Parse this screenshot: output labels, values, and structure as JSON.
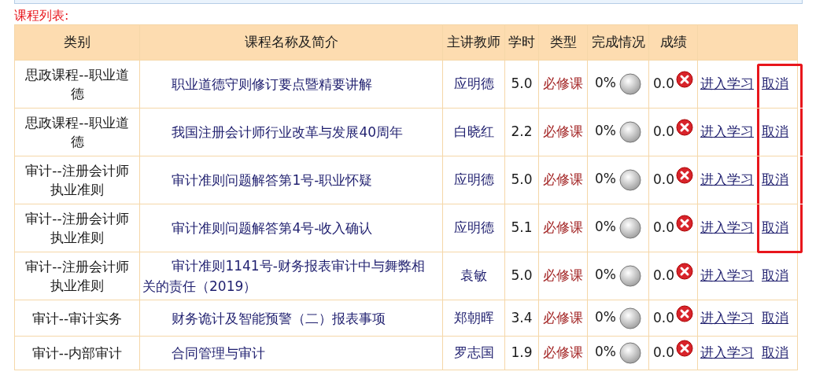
{
  "title": "课程列表:",
  "columns": [
    "类别",
    "课程名称及简介",
    "主讲教师",
    "学时",
    "类型",
    "完成情况",
    "成绩"
  ],
  "rows": [
    {
      "category": "思政课程--职业道德",
      "name": "职业道德守则修订要点暨精要讲解",
      "teacher": "应明德",
      "hours": "5.0",
      "type": "必修课",
      "progress": "0%",
      "score": "0.0",
      "enter": "进入学习",
      "cancel": "取消",
      "cancel_highlighted": true
    },
    {
      "category": "思政课程--职业道德",
      "name": "我国注册会计师行业改革与发展40周年",
      "teacher": "白晓红",
      "hours": "2.2",
      "type": "必修课",
      "progress": "0%",
      "score": "0.0",
      "enter": "进入学习",
      "cancel": "取消",
      "cancel_highlighted": true
    },
    {
      "category": "审计--注册会计师执业准则",
      "name": "审计准则问题解答第1号-职业怀疑",
      "teacher": "应明德",
      "hours": "5.0",
      "type": "必修课",
      "progress": "0%",
      "score": "0.0",
      "enter": "进入学习",
      "cancel": "取消",
      "cancel_highlighted": true
    },
    {
      "category": "审计--注册会计师执业准则",
      "name": "审计准则问题解答第4号-收入确认",
      "teacher": "应明德",
      "hours": "5.1",
      "type": "必修课",
      "progress": "0%",
      "score": "0.0",
      "enter": "进入学习",
      "cancel": "取消",
      "cancel_highlighted": true
    },
    {
      "category": "审计--注册会计师执业准则",
      "name": "审计准则1141号-财务报表审计中与舞弊相关的责任（2019）",
      "teacher": "袁敏",
      "hours": "5.0",
      "type": "必修课",
      "progress": "0%",
      "score": "0.0",
      "enter": "进入学习",
      "cancel": "取消",
      "cancel_highlighted": false
    },
    {
      "category": "审计--审计实务",
      "name": "财务诡计及智能预警（二）报表事项",
      "teacher": "郑朝晖",
      "hours": "3.4",
      "type": "必修课",
      "progress": "0%",
      "score": "0.0",
      "enter": "进入学习",
      "cancel": "取消",
      "cancel_highlighted": false
    },
    {
      "category": "审计--内部审计",
      "name": "合同管理与审计",
      "teacher": "罗志国",
      "hours": "1.9",
      "type": "必修课",
      "progress": "0%",
      "score": "0.0",
      "enter": "进入学习",
      "cancel": "取消",
      "cancel_highlighted": false
    }
  ]
}
